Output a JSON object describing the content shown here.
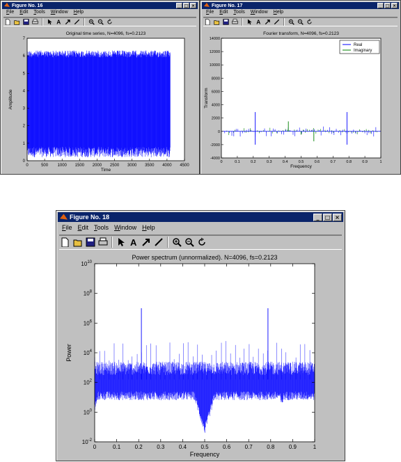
{
  "menu": [
    "File",
    "Edit",
    "Tools",
    "Window",
    "Help"
  ],
  "colors": {
    "title_bg": "#0a246a",
    "window_bg": "#c0c0c0",
    "signal": "#0000ff",
    "imag": "#008000"
  },
  "icons": [
    "new-file-icon",
    "open-folder-icon",
    "save-icon",
    "print-icon",
    "select-arrow-icon",
    "text-tool-icon",
    "arrow-tool-icon",
    "line-tool-icon",
    "zoom-in-icon",
    "zoom-out-icon",
    "rotate-icon"
  ],
  "windows": {
    "fig16": {
      "title": "Figure No. 16"
    },
    "fig17": {
      "title": "Figure No. 17"
    },
    "fig18": {
      "title": "Figure No. 18"
    }
  },
  "chart_data": [
    {
      "type": "line",
      "title": "Original time series, N=4096, fs=0.2123",
      "xlabel": "Time",
      "ylabel": "Amplitude",
      "xlim": [
        0,
        4500
      ],
      "ylim": [
        0,
        7
      ],
      "xticks": [
        "0",
        "500",
        "1000",
        "1500",
        "2000",
        "2500",
        "3000",
        "3500",
        "4000",
        "4500"
      ],
      "yticks": [
        "0",
        "1",
        "2",
        "3",
        "4",
        "5",
        "6",
        "7"
      ],
      "series": [
        {
          "color": "#0000ff",
          "n_points": 4096,
          "approx_min": 0.2,
          "approx_max": 6.3,
          "x_range": [
            0,
            4096
          ]
        }
      ]
    },
    {
      "type": "line",
      "title": "Fourier transform, N=4096, fs=0.2123",
      "xlabel": "Frequency",
      "ylabel": "Transform",
      "xlim": [
        0,
        1
      ],
      "ylim": [
        -4000,
        14000
      ],
      "xticks": [
        "0",
        "0.1",
        "0.2",
        "0.3",
        "0.4",
        "0.5",
        "0.6",
        "0.7",
        "0.8",
        "0.9",
        "1"
      ],
      "yticks": [
        "-4000",
        "-2000",
        "0",
        "2000",
        "4000",
        "6000",
        "8000",
        "10000",
        "12000",
        "14000"
      ],
      "legend": [
        "Real",
        "Imaginary"
      ],
      "legend_position": "top-right",
      "series": [
        {
          "name": "Real",
          "color": "#0000ff",
          "peaks": [
            {
              "x": 0.2123,
              "y": 2900
            },
            {
              "x": 0.2123,
              "y": -2000
            },
            {
              "x": 0.7877,
              "y": 2900
            },
            {
              "x": 0.7877,
              "y": -2000
            }
          ]
        },
        {
          "name": "Imaginary",
          "color": "#008000",
          "peaks": [
            {
              "x": 0.42,
              "y": 1500
            },
            {
              "x": 0.58,
              "y": -1500
            },
            {
              "x": 0.5,
              "y": -500
            }
          ]
        }
      ]
    },
    {
      "type": "line",
      "title": "Power spectrum (unnormalized). N=4096, fs=0.2123",
      "xlabel": "Frequency",
      "ylabel": "Power",
      "xlim": [
        0,
        1
      ],
      "ylim_log10": [
        -2,
        10
      ],
      "y_scale": "log",
      "xticks": [
        "0",
        "0.1",
        "0.2",
        "0.3",
        "0.4",
        "0.5",
        "0.6",
        "0.7",
        "0.8",
        "0.9",
        "1"
      ],
      "yticks_exp": [
        "-2",
        "0",
        "2",
        "4",
        "6",
        "8",
        "10"
      ],
      "series": [
        {
          "color": "#0000ff",
          "baseline_log10": 2.2,
          "main_peaks": [
            {
              "x": 0.2123,
              "log10": 7
            },
            {
              "x": 0.7877,
              "log10": 7
            }
          ],
          "dips": [
            {
              "x": 0.0,
              "log10": 0
            },
            {
              "x": 0.5,
              "log10": -1.5
            },
            {
              "x": 0.85,
              "log10": 0.3
            }
          ]
        }
      ]
    }
  ]
}
